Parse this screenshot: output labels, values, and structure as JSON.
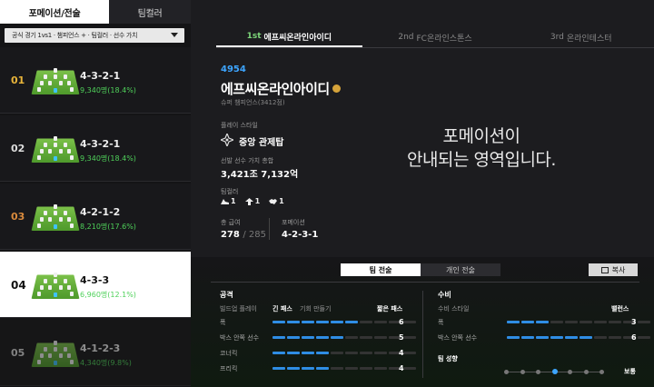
{
  "tabs": [
    "포메이션/전술",
    "팀컬러"
  ],
  "filter": "공식 경기 1vs1 · 챔피언스 + · 팀컬러 · 선수 가치",
  "formations": [
    {
      "rank": "01",
      "name": "4-3-2-1",
      "count": "9,340명(18.4%)"
    },
    {
      "rank": "02",
      "name": "4-3-2-1",
      "count": "9,340명(18.4%)"
    },
    {
      "rank": "03",
      "name": "4-2-1-2",
      "count": "8,210명(17.6%)"
    },
    {
      "rank": "04",
      "name": "4-3-3",
      "count": "6,960명(12.1%)"
    },
    {
      "rank": "05",
      "name": "4-1-2-3",
      "count": "4,340명(9.8%)"
    }
  ],
  "user_tabs": [
    {
      "ord": "1st",
      "name": "에프씨온라인아이디"
    },
    {
      "ord": "2nd",
      "name": "FC온라인스톤스"
    },
    {
      "ord": "3rd",
      "name": "온라인테스터"
    }
  ],
  "profile": {
    "id": "4954",
    "name": "에프씨온라인아이디",
    "rank": "슈퍼 챔피언스(3412점)",
    "style_label": "플레이 스타일",
    "style": "중앙 관제탑",
    "value_label": "선발 선수 가치 총합",
    "value": "3,421조 7,132억",
    "teamcolor_label": "팀컬러",
    "teamcolors": [
      "1",
      "1",
      "1"
    ],
    "pay_label": "총 급여",
    "pay": "278",
    "pay_max": "/ 285",
    "formation_label": "포메이션",
    "formation": "4-2-3-1"
  },
  "placeholder": [
    "포메이션이",
    "안내되는 영역입니다."
  ],
  "bottom": {
    "tabs": [
      "팀 전술",
      "개인 전술"
    ],
    "copy": "복사",
    "attack": {
      "title": "공격",
      "header": {
        "label": "빌드업 플레이",
        "left": "긴 패스",
        "mid": "기회 만들기",
        "right": "짧은 패스"
      },
      "rows": [
        {
          "label": "폭",
          "value": "6",
          "on": 6
        },
        {
          "label": "박스 안쪽 선수",
          "value": "5",
          "on": 5
        },
        {
          "label": "코너킥",
          "value": "4",
          "on": 4
        },
        {
          "label": "프리킥",
          "value": "4",
          "on": 4
        }
      ]
    },
    "defense": {
      "title": "수비",
      "header": {
        "label": "수비 스타일",
        "right": "밸런스"
      },
      "rows": [
        {
          "label": "폭",
          "value": "3",
          "on": 3
        },
        {
          "label": "박스 안쪽 선수",
          "value": "6",
          "on": 6
        }
      ],
      "tendency_label": "팀 성향",
      "tendency": "보통",
      "tendency_level": 4
    }
  }
}
